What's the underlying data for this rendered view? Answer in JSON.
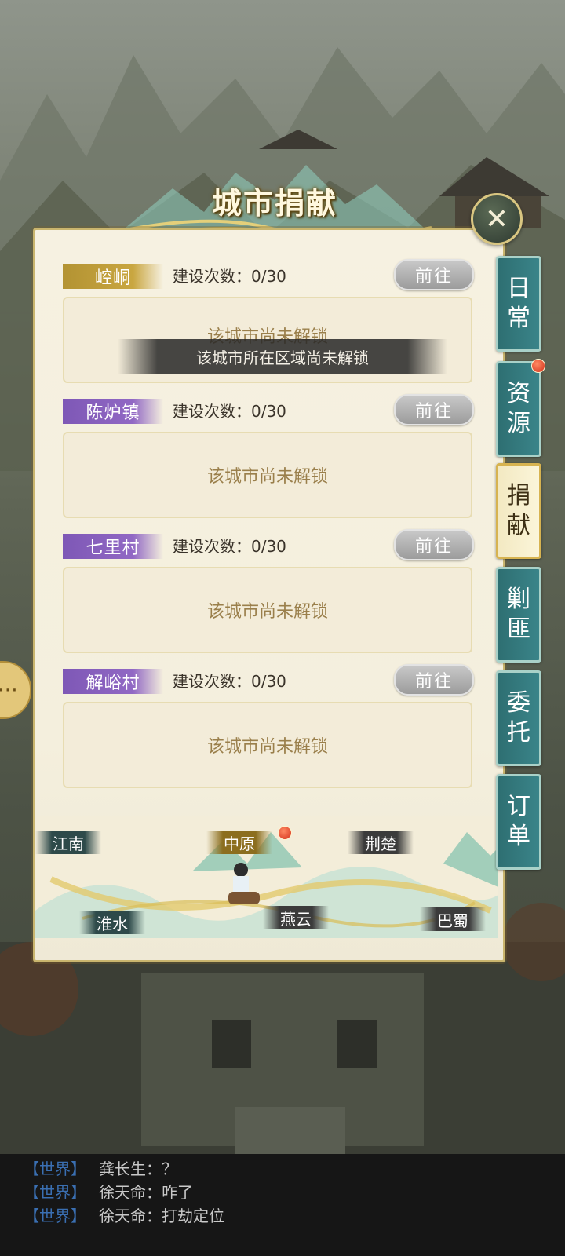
{
  "panel": {
    "title": "城市捐献",
    "close_glyph": "✕"
  },
  "cities": [
    {
      "name": "崆峒",
      "tag_color": "gold",
      "build_label": "建设次数：0/30",
      "goto_label": "前往",
      "status": "该城市尚未解锁"
    },
    {
      "name": "陈炉镇",
      "tag_color": "purple",
      "build_label": "建设次数：0/30",
      "goto_label": "前往",
      "status": "该城市尚未解锁"
    },
    {
      "name": "七里村",
      "tag_color": "purple",
      "build_label": "建设次数：0/30",
      "goto_label": "前往",
      "status": "该城市尚未解锁"
    },
    {
      "name": "解峪村",
      "tag_color": "purple",
      "build_label": "建设次数：0/30",
      "goto_label": "前往",
      "status": "该城市尚未解锁"
    }
  ],
  "toast": "该城市所在区域尚未解锁",
  "regions": {
    "jiangnan": "江南",
    "zhongyuan": "中原",
    "jingchu": "荆楚",
    "huaishui": "淮水",
    "yanyun": "燕云",
    "bashu": "巴蜀"
  },
  "tabs": [
    {
      "label": "日常",
      "active": false,
      "dot": false
    },
    {
      "label": "资源",
      "active": false,
      "dot": true
    },
    {
      "label": "捐献",
      "active": true,
      "dot": false
    },
    {
      "label": "剿匪",
      "active": false,
      "dot": false
    },
    {
      "label": "委托",
      "active": false,
      "dot": false
    },
    {
      "label": "订单",
      "active": false,
      "dot": false
    }
  ],
  "tab_chars": [
    [
      "日",
      "常"
    ],
    [
      "资",
      "源"
    ],
    [
      "捐",
      "献"
    ],
    [
      "剿",
      "匪"
    ],
    [
      "委",
      "托"
    ],
    [
      "订",
      "单"
    ]
  ],
  "chat": [
    {
      "channel": "【世界】",
      "name": "龚长生：",
      "msg": "？"
    },
    {
      "channel": "【世界】",
      "name": "徐天命：",
      "msg": "咋了"
    },
    {
      "channel": "【世界】",
      "name": "徐天命：",
      "msg": "打劫定位"
    }
  ],
  "colors": {
    "tag_gold": "#c9a640",
    "tag_purple": "#9168c4",
    "tab_teal": "#3a8489",
    "chat_channel": "#3a6fb2"
  }
}
